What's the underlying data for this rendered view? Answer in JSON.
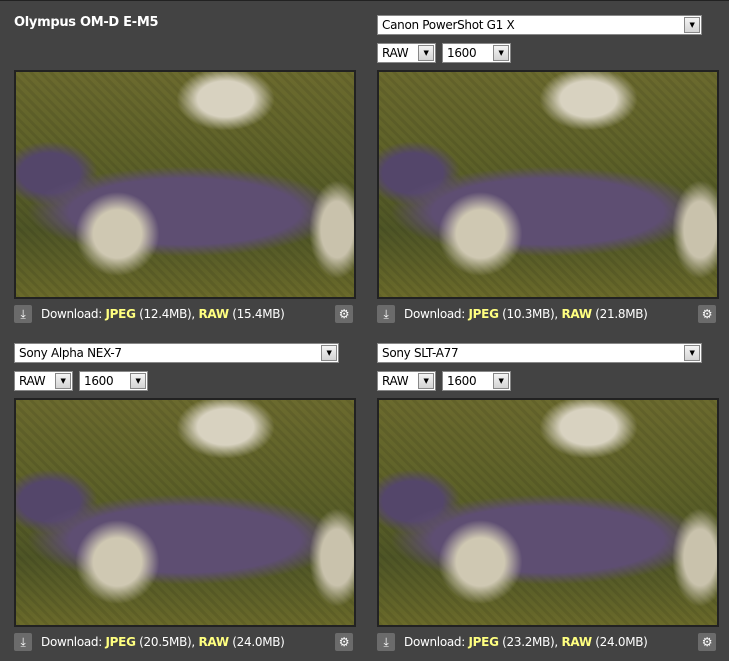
{
  "panels": [
    {
      "title": "Olympus OM-D E-M5",
      "jpeg": "(12.4MB)",
      "raw": "(15.4MB)"
    },
    {
      "camera": "Canon PowerShot G1 X",
      "format": "RAW",
      "iso": "1600",
      "jpeg": "(10.3MB)",
      "raw": "(21.8MB)"
    },
    {
      "camera": "Sony Alpha NEX-7",
      "format": "RAW",
      "iso": "1600",
      "jpeg": "(20.5MB)",
      "raw": "(24.0MB)"
    },
    {
      "camera": "Sony SLT-A77",
      "format": "RAW",
      "iso": "1600",
      "jpeg": "(23.2MB)",
      "raw": "(24.0MB)"
    }
  ],
  "labels": {
    "download": "Download:",
    "jpeg": "JPEG",
    "raw": "RAW",
    "comma": ","
  },
  "colors": {
    "background": "#434343",
    "highlight": "#ffff80"
  }
}
